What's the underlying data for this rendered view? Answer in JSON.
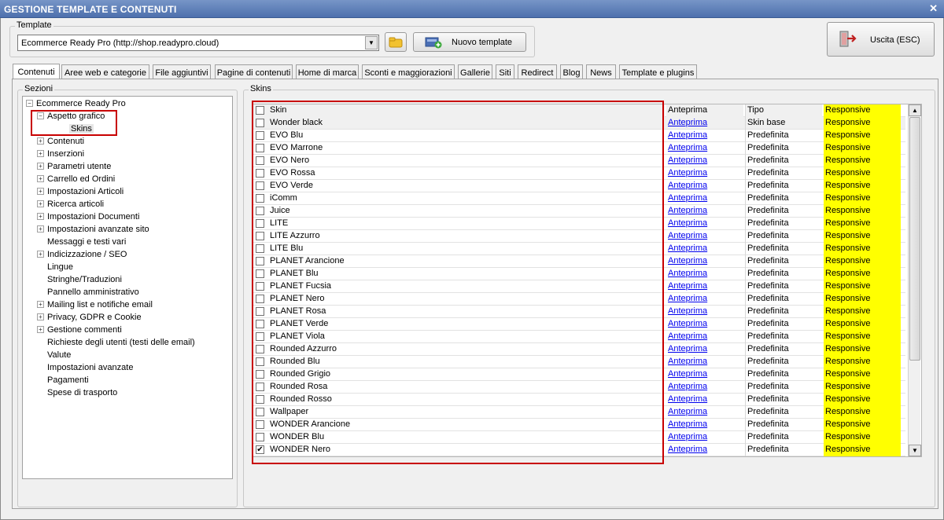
{
  "window": {
    "title": "GESTIONE TEMPLATE E CONTENUTI",
    "close": "✕"
  },
  "template": {
    "group_label": "Template",
    "selected": "Ecommerce Ready Pro (http://shop.readypro.cloud)",
    "new_button": "Nuovo template"
  },
  "exit_button": "Uscita (ESC)",
  "tabs": [
    "Contenuti",
    "Aree web e categorie",
    "File aggiuntivi",
    "Pagine di contenuti",
    "Home di marca",
    "Sconti e maggiorazioni",
    "Gallerie",
    "Siti",
    "Redirect",
    "Blog",
    "News",
    "Template e plugins"
  ],
  "active_tab": "Contenuti",
  "sections": {
    "label": "Sezioni",
    "root": "Ecommerce Ready Pro",
    "items": [
      {
        "label": "Aspetto grafico",
        "level": 1,
        "expander": "−"
      },
      {
        "label": "Skins",
        "level": 2,
        "expander": "",
        "selected": true
      },
      {
        "label": "Contenuti",
        "level": 1,
        "expander": "+"
      },
      {
        "label": "Inserzioni",
        "level": 1,
        "expander": "+"
      },
      {
        "label": "Parametri utente",
        "level": 1,
        "expander": "+"
      },
      {
        "label": "Carrello ed Ordini",
        "level": 1,
        "expander": "+"
      },
      {
        "label": "Impostazioni Articoli",
        "level": 1,
        "expander": "+"
      },
      {
        "label": "Ricerca articoli",
        "level": 1,
        "expander": "+"
      },
      {
        "label": "Impostazioni Documenti",
        "level": 1,
        "expander": "+"
      },
      {
        "label": "Impostazioni avanzate sito",
        "level": 1,
        "expander": "+"
      },
      {
        "label": "Messaggi e testi vari",
        "level": 1,
        "expander": ""
      },
      {
        "label": "Indicizzazione / SEO",
        "level": 1,
        "expander": "+"
      },
      {
        "label": "Lingue",
        "level": 1,
        "expander": ""
      },
      {
        "label": "Stringhe/Traduzioni",
        "level": 1,
        "expander": ""
      },
      {
        "label": "Pannello amministrativo",
        "level": 1,
        "expander": ""
      },
      {
        "label": "Mailing list e notifiche email",
        "level": 1,
        "expander": "+"
      },
      {
        "label": "Privacy, GDPR e Cookie",
        "level": 1,
        "expander": "+"
      },
      {
        "label": "Gestione commenti",
        "level": 1,
        "expander": "+"
      },
      {
        "label": "Richieste degli utenti (testi delle email)",
        "level": 1,
        "expander": ""
      },
      {
        "label": "Valute",
        "level": 1,
        "expander": ""
      },
      {
        "label": "Impostazioni avanzate",
        "level": 1,
        "expander": ""
      },
      {
        "label": "Pagamenti",
        "level": 1,
        "expander": ""
      },
      {
        "label": "Spese di trasporto",
        "level": 1,
        "expander": ""
      }
    ]
  },
  "skins": {
    "label": "Skins",
    "columns": {
      "skin": "Skin",
      "preview": "Anteprima",
      "type": "Tipo",
      "responsive": "Responsive"
    },
    "rows": [
      {
        "name": "Wonder black",
        "preview": "Anteprima",
        "type": "Skin base",
        "responsive": "Responsive",
        "checked": false
      },
      {
        "name": "EVO Blu",
        "preview": "Anteprima",
        "type": "Predefinita",
        "responsive": "Responsive",
        "checked": false
      },
      {
        "name": "EVO Marrone",
        "preview": "Anteprima",
        "type": "Predefinita",
        "responsive": "Responsive",
        "checked": false
      },
      {
        "name": "EVO Nero",
        "preview": "Anteprima",
        "type": "Predefinita",
        "responsive": "Responsive",
        "checked": false
      },
      {
        "name": "EVO Rossa",
        "preview": "Anteprima",
        "type": "Predefinita",
        "responsive": "Responsive",
        "checked": false
      },
      {
        "name": "EVO Verde",
        "preview": "Anteprima",
        "type": "Predefinita",
        "responsive": "Responsive",
        "checked": false
      },
      {
        "name": "iComm",
        "preview": "Anteprima",
        "type": "Predefinita",
        "responsive": "Responsive",
        "checked": false
      },
      {
        "name": "Juice",
        "preview": "Anteprima",
        "type": "Predefinita",
        "responsive": "Responsive",
        "checked": false
      },
      {
        "name": "LITE",
        "preview": "Anteprima",
        "type": "Predefinita",
        "responsive": "Responsive",
        "checked": false
      },
      {
        "name": "LITE Azzurro",
        "preview": "Anteprima",
        "type": "Predefinita",
        "responsive": "Responsive",
        "checked": false
      },
      {
        "name": "LITE Blu",
        "preview": "Anteprima",
        "type": "Predefinita",
        "responsive": "Responsive",
        "checked": false
      },
      {
        "name": "PLANET Arancione",
        "preview": "Anteprima",
        "type": "Predefinita",
        "responsive": "Responsive",
        "checked": false
      },
      {
        "name": "PLANET Blu",
        "preview": "Anteprima",
        "type": "Predefinita",
        "responsive": "Responsive",
        "checked": false
      },
      {
        "name": "PLANET Fucsia",
        "preview": "Anteprima",
        "type": "Predefinita",
        "responsive": "Responsive",
        "checked": false
      },
      {
        "name": "PLANET Nero",
        "preview": "Anteprima",
        "type": "Predefinita",
        "responsive": "Responsive",
        "checked": false
      },
      {
        "name": "PLANET Rosa",
        "preview": "Anteprima",
        "type": "Predefinita",
        "responsive": "Responsive",
        "checked": false
      },
      {
        "name": "PLANET Verde",
        "preview": "Anteprima",
        "type": "Predefinita",
        "responsive": "Responsive",
        "checked": false
      },
      {
        "name": "PLANET Viola",
        "preview": "Anteprima",
        "type": "Predefinita",
        "responsive": "Responsive",
        "checked": false
      },
      {
        "name": "Rounded Azzurro",
        "preview": "Anteprima",
        "type": "Predefinita",
        "responsive": "Responsive",
        "checked": false
      },
      {
        "name": "Rounded Blu",
        "preview": "Anteprima",
        "type": "Predefinita",
        "responsive": "Responsive",
        "checked": false
      },
      {
        "name": "Rounded Grigio",
        "preview": "Anteprima",
        "type": "Predefinita",
        "responsive": "Responsive",
        "checked": false
      },
      {
        "name": "Rounded Rosa",
        "preview": "Anteprima",
        "type": "Predefinita",
        "responsive": "Responsive",
        "checked": false
      },
      {
        "name": "Rounded Rosso",
        "preview": "Anteprima",
        "type": "Predefinita",
        "responsive": "Responsive",
        "checked": false
      },
      {
        "name": "Wallpaper",
        "preview": "Anteprima",
        "type": "Predefinita",
        "responsive": "Responsive",
        "checked": false
      },
      {
        "name": "WONDER Arancione",
        "preview": "Anteprima",
        "type": "Predefinita",
        "responsive": "Responsive",
        "checked": false
      },
      {
        "name": "WONDER Blu",
        "preview": "Anteprima",
        "type": "Predefinita",
        "responsive": "Responsive",
        "checked": false
      },
      {
        "name": "WONDER Nero",
        "preview": "Anteprima",
        "type": "Predefinita",
        "responsive": "Responsive",
        "checked": true
      }
    ]
  },
  "icons": {
    "folder": "folder-icon",
    "new_template": "new-template-icon",
    "exit": "exit-icon"
  },
  "colors": {
    "titlebar": "#5a7bb8",
    "responsive_highlight": "#ffff00",
    "annotation_red": "#c80000",
    "link": "#0000ee"
  }
}
